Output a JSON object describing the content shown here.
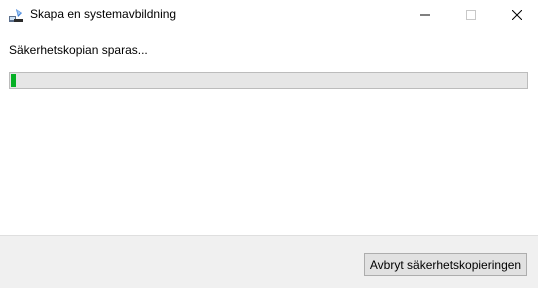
{
  "window": {
    "title": "Skapa en systemavbildning",
    "icon": "backup-app-icon"
  },
  "main": {
    "status_text": "Säkerhetskopian sparas...",
    "progress_fraction": 0.01
  },
  "footer": {
    "cancel_label": "Avbryt säkerhetskopieringen"
  },
  "colors": {
    "progress_fill": "#06b025",
    "progress_track": "#e6e6e6",
    "footer_bg": "#f0f0f0"
  }
}
